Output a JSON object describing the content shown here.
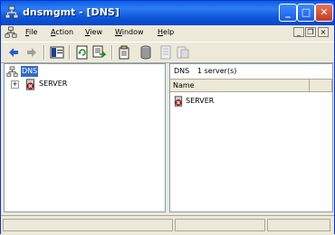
{
  "window": {
    "title": "dnsmgmt - [DNS]",
    "controls": [
      "minimize",
      "maximize",
      "close"
    ]
  },
  "menubar": {
    "items": [
      {
        "u": "F",
        "rest": "ile"
      },
      {
        "u": "A",
        "rest": "ction"
      },
      {
        "u": "V",
        "rest": "iew"
      },
      {
        "u": "W",
        "rest": "indow"
      },
      {
        "u": "H",
        "rest": "elp"
      }
    ]
  },
  "toolbar": {
    "icons": [
      "back-icon",
      "forward-icon",
      "show-hide-tree-icon",
      "refresh-icon",
      "export-list-icon",
      "properties-icon",
      "new-zone-icon",
      "record-icon",
      "record2-icon"
    ]
  },
  "tree": {
    "root_label": "DNS",
    "child_label": "SERVER",
    "expander": "+"
  },
  "right_pane": {
    "header_title": "DNS",
    "header_count": "1 server(s)",
    "columns": [
      "Name",
      ""
    ],
    "rows": [
      {
        "name": "SERVER"
      }
    ]
  },
  "colors": {
    "title_bar": "#0a5fe0",
    "selection": "#316ac5",
    "close_button": "#c6391e"
  }
}
